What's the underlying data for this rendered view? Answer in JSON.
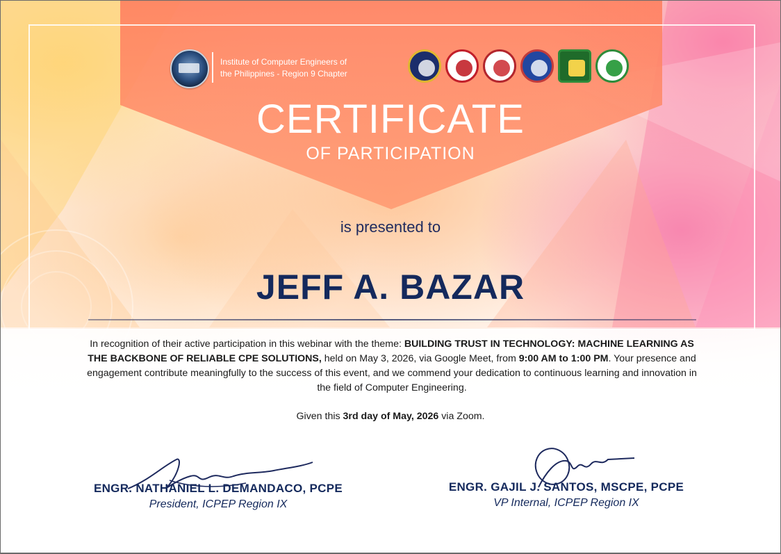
{
  "organization": {
    "name_line1": "Institute of Computer Engineers of",
    "name_line2": "the Philippines - Region 9 Chapter"
  },
  "partner_seals": [
    "university-seal-icon",
    "st-peters-college-seal-icon",
    "university-seal-icon",
    "college-seal-icon",
    "university-seal-icon",
    "college-seal-icon"
  ],
  "certificate": {
    "title": "CERTIFICATE",
    "subtitle": "OF PARTICIPATION",
    "presented_to": "is presented to",
    "recipient": "JEFF A. BAZAR"
  },
  "body": {
    "intro": "In recognition of their active participation in this webinar with the theme: ",
    "theme": "BUILDING TRUST IN TECHNOLOGY: MACHINE LEARNING AS THE BACKBONE OF RELIABLE CPE SOLUTIONS,",
    "held": " held on May 3, 2026, via Google Meet, from ",
    "time": "9:00 AM to 1:00 PM",
    "closing": ". Your presence and engagement contribute meaningfully to the success of this event, and we commend your dedication to continuous learning and innovation in the field of Computer Engineering."
  },
  "given": {
    "prefix": "Given this ",
    "date": "3rd day of May, 2026",
    "suffix": " via Zoom."
  },
  "signatories": [
    {
      "name": "ENGR. NATHANIEL L. DEMANDACO, PCPE",
      "title": "President, ICPEP Region IX"
    },
    {
      "name": "ENGR. GAJIL J. SANTOS, MSCPE, PCPE",
      "title": "VP Internal, ICPEP Region IX"
    }
  ],
  "colors": {
    "navy": "#14295c",
    "banner": "#ff8060",
    "accent_pink": "#f678aa",
    "accent_yellow": "#ffd678"
  }
}
